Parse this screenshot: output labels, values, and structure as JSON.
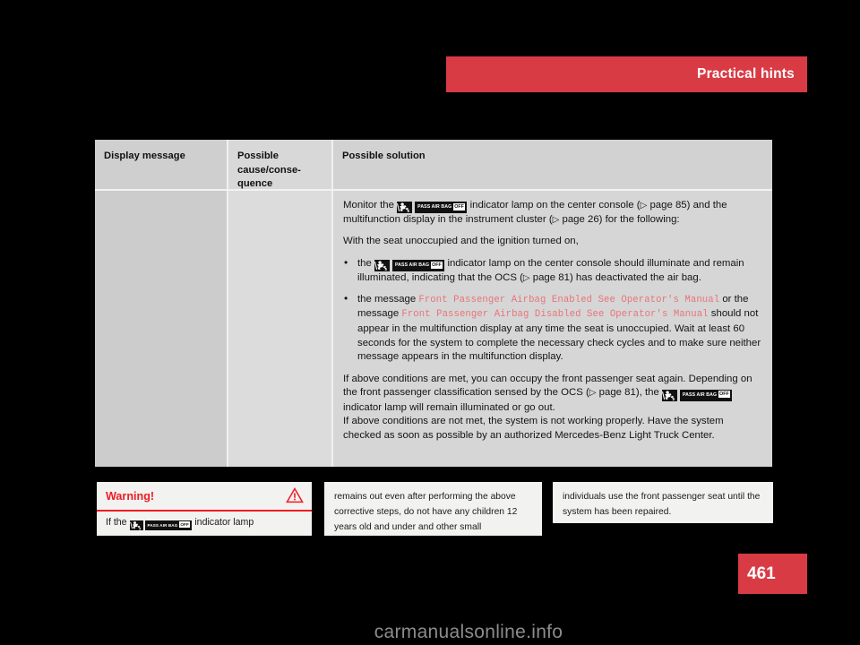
{
  "header": {
    "title": "Practical hints",
    "accent_color": "#d93b45"
  },
  "page_number": "461",
  "watermark": "carmanualsonline.info",
  "table": {
    "columns": [
      {
        "header": "Display message",
        "cell": ""
      },
      {
        "header": "Possible cause/conse-quence",
        "cell": ""
      },
      {
        "header": "Possible solution"
      }
    ],
    "solution": {
      "intro_a": "Monitor the ",
      "intro_b": " indicator lamp on the center console (",
      "intro_ref1": "page 85",
      "intro_c": ") and the multifunction display in the instrument cluster (",
      "intro_ref2": "page 26",
      "intro_d": ") for the following:",
      "condition": "With the seat unoccupied and the ignition turned on,",
      "bullet1_a": "the ",
      "bullet1_b": " indicator lamp on the center console should illuminate and remain illuminated, indicating that the OCS (",
      "bullet1_ref": "page 81",
      "bullet1_c": ") has deactivated the air bag.",
      "bullet2_a": "the message ",
      "bullet2_msg1": "Front Passenger Airbag Enabled See Operator's Manual",
      "bullet2_b": " or the message ",
      "bullet2_msg2": "Front Passenger Airbag Disabled See Operator's Manual",
      "bullet2_c": " should not appear in the multifunction display at any time the seat is unoccupied. Wait at least 60 seconds for the system to complete the necessary check cycles and to make sure neither message appears in the multifunction display.",
      "closing_a": "If above conditions are met, you can occupy the front passenger seat again. Depending on the front passenger classification sensed by the OCS (",
      "closing_ref": "page 81",
      "closing_b": "), the ",
      "closing_c": " indicator lamp will remain illuminated or go out.",
      "closing_d": "If above conditions are not met, the system is not working properly. Have the system checked as soon as possible by an authorized Mercedes-Benz Light Truck Center."
    }
  },
  "lamp": {
    "pictogram_name": "child-seat-airbag-off-pictogram",
    "badge_text": "PASS AIR BAG",
    "badge_off": "OFF"
  },
  "warning_boxes": [
    {
      "title": "Warning!",
      "icon": "warning-triangle-icon",
      "text_a": "If the ",
      "text_b": " indicator lamp"
    },
    {
      "text": "remains out even after performing the above corrective steps, do not have any children 12 years old and under and other small"
    },
    {
      "text": "individuals use the front passenger seat until the system has been repaired."
    }
  ]
}
